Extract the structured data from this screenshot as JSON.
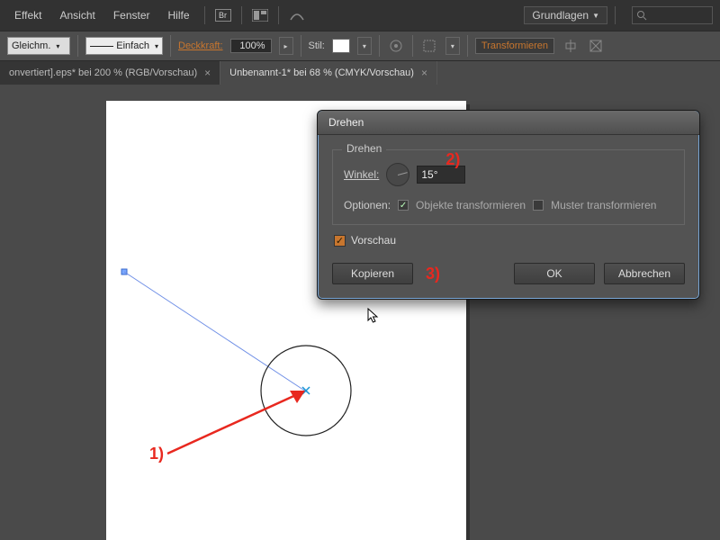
{
  "menubar": {
    "items": [
      "Effekt",
      "Ansicht",
      "Fenster",
      "Hilfe"
    ],
    "workspace": "Grundlagen",
    "br": "Br"
  },
  "optbar": {
    "align": "Gleichm.",
    "stroke": "Einfach",
    "opacity_label": "Deckkraft:",
    "opacity_value": "100%",
    "style_label": "Stil:",
    "transform": "Transformieren"
  },
  "tabs": [
    {
      "label": "onvertiert].eps* bei 200 % (RGB/Vorschau)",
      "active": false
    },
    {
      "label": "Unbenannt-1* bei 68 % (CMYK/Vorschau)",
      "active": true
    }
  ],
  "dialog": {
    "title": "Drehen",
    "legend": "Drehen",
    "angle_label": "Winkel:",
    "angle_value": "15°",
    "options_label": "Optionen:",
    "opt_objects": "Objekte transformieren",
    "opt_patterns": "Muster transformieren",
    "preview": "Vorschau",
    "btn_copy": "Kopieren",
    "btn_ok": "OK",
    "btn_cancel": "Abbrechen"
  },
  "annotations": {
    "a1": "1)",
    "a2": "2)",
    "a3": "3)"
  }
}
